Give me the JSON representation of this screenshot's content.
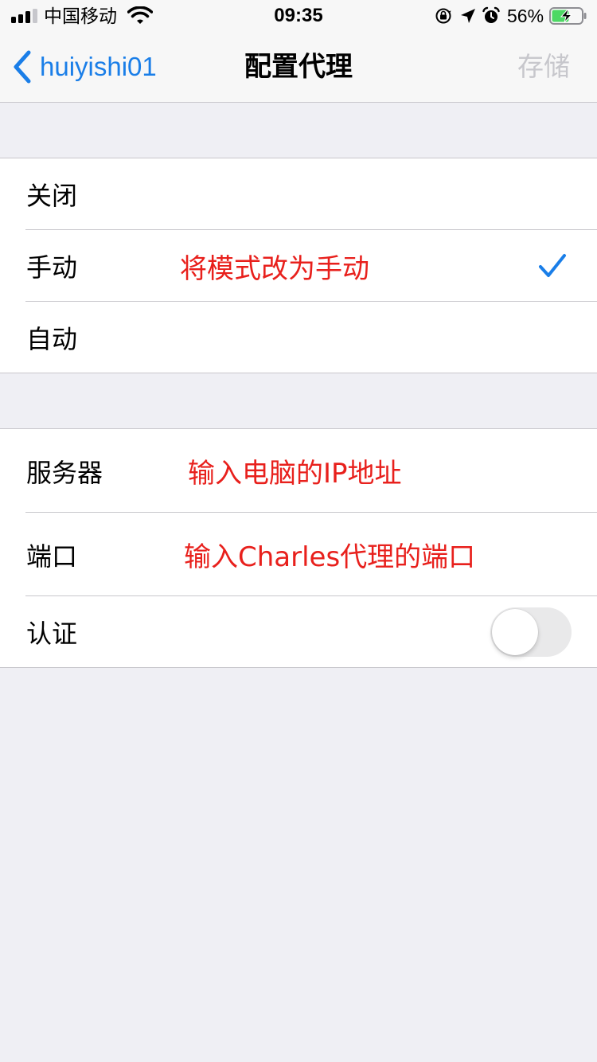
{
  "status_bar": {
    "carrier": "中国移动",
    "time": "09:35",
    "battery_percent": "56%",
    "signal_bars": 3,
    "icons": [
      "signal-icon",
      "wifi-icon",
      "orientation-lock-icon",
      "location-icon",
      "alarm-icon",
      "battery-charging-icon"
    ]
  },
  "nav": {
    "back_label": "huiyishi01",
    "title": "配置代理",
    "save_label": "存储"
  },
  "mode_group": {
    "items": [
      {
        "label": "关闭",
        "selected": false
      },
      {
        "label": "手动",
        "selected": true,
        "annotation": "将模式改为手动"
      },
      {
        "label": "自动",
        "selected": false
      }
    ]
  },
  "proxy_group": {
    "server": {
      "label": "服务器",
      "annotation": "输入电脑的IP地址"
    },
    "port": {
      "label": "端口",
      "annotation": "输入Charles代理的端口"
    },
    "auth": {
      "label": "认证",
      "enabled": false
    }
  },
  "colors": {
    "accent": "#1a7ee8",
    "annotation": "#e8201c",
    "background": "#efeff4",
    "separator": "#c8c7cc",
    "disabled_text": "#c7c7cc"
  }
}
